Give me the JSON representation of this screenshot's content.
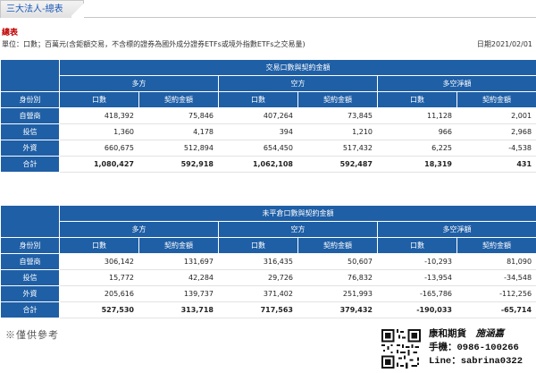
{
  "tab": {
    "label": "三大法人-總表"
  },
  "section_title": "總表",
  "unit_note": "單位：口數；百萬元(含鉅額交易，不含標的證券為國外成分證券ETFs或境外指數ETFs之交易量)",
  "date_label": "日期2021/02/01",
  "table_trading": {
    "title": "交易口數與契約金額",
    "identity_header": "身份別",
    "groups": [
      "多方",
      "空方",
      "多空淨額"
    ],
    "columns": [
      "口數",
      "契約金額",
      "口數",
      "契約金額",
      "口數",
      "契約金額"
    ],
    "rows": [
      {
        "label": "自營商",
        "values": [
          "418,392",
          "75,846",
          "407,264",
          "73,845",
          "11,128",
          "2,001"
        ]
      },
      {
        "label": "投信",
        "values": [
          "1,360",
          "4,178",
          "394",
          "1,210",
          "966",
          "2,968"
        ]
      },
      {
        "label": "外資",
        "values": [
          "660,675",
          "512,894",
          "654,450",
          "517,432",
          "6,225",
          "-4,538"
        ]
      },
      {
        "label": "合計",
        "values": [
          "1,080,427",
          "592,918",
          "1,062,108",
          "592,487",
          "18,319",
          "431"
        ]
      }
    ]
  },
  "table_open_interest": {
    "title": "未平倉口數與契約金額",
    "identity_header": "身份別",
    "groups": [
      "多方",
      "空方",
      "多空淨額"
    ],
    "columns": [
      "口數",
      "契約金額",
      "口數",
      "契約金額",
      "口數",
      "契約金額"
    ],
    "rows": [
      {
        "label": "自營商",
        "values": [
          "306,142",
          "131,697",
          "316,435",
          "50,607",
          "-10,293",
          "81,090"
        ]
      },
      {
        "label": "投信",
        "values": [
          "15,772",
          "42,284",
          "29,726",
          "76,832",
          "-13,954",
          "-34,548"
        ]
      },
      {
        "label": "外資",
        "values": [
          "205,616",
          "139,737",
          "371,402",
          "251,993",
          "-165,786",
          "-112,256"
        ]
      },
      {
        "label": "合計",
        "values": [
          "527,530",
          "313,718",
          "717,563",
          "379,432",
          "-190,033",
          "-65,714"
        ]
      }
    ]
  },
  "footnote": "※僅供參考",
  "stamp": {
    "line1": "康和期貨",
    "name": "施涵嘉",
    "line2": "手機：0986-100266",
    "line3": "Line：sabrina0322"
  },
  "colors": {
    "header_blue": "#1f5fa6",
    "tab_text": "#1b58b8",
    "section_red": "#c00000"
  },
  "icons": {
    "qr": "qr-code-icon"
  }
}
